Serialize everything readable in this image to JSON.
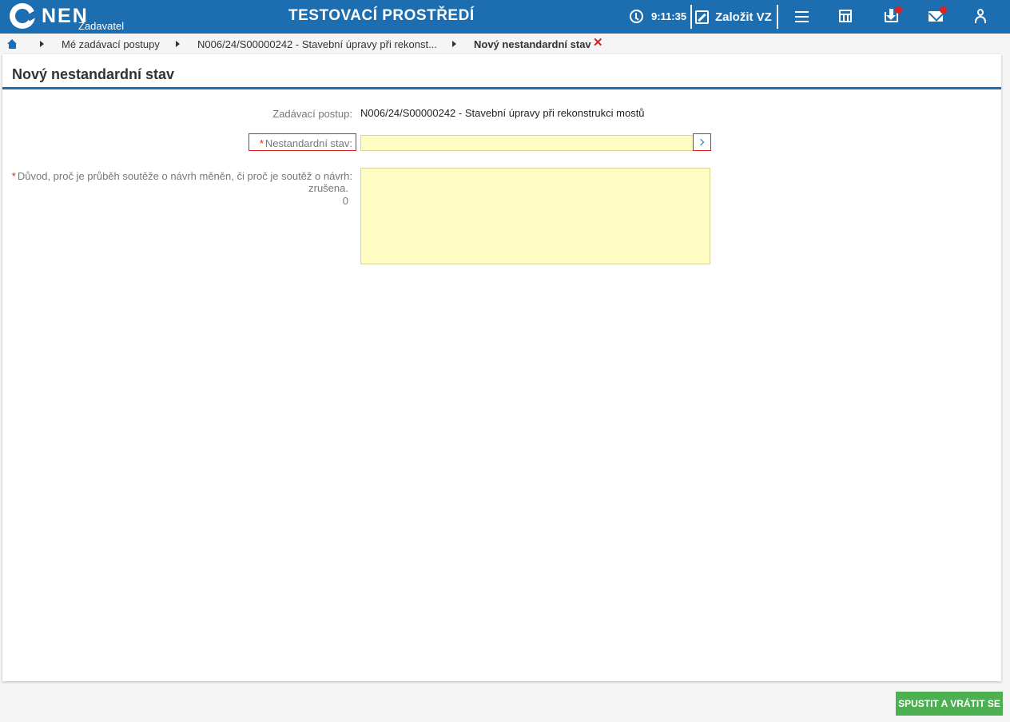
{
  "header": {
    "logo_text": "NEN",
    "logo_subtitle": "Zadavatel",
    "environment_title": "TESTOVACÍ PROSTŘEDÍ",
    "time": "9:11:35",
    "create_label": "Založit VZ",
    "icons": [
      "clock-icon",
      "edit-icon",
      "menu-icon",
      "calculator-icon",
      "inbox-icon",
      "mail-icon",
      "user-icon"
    ],
    "notification_color": "#e0201b"
  },
  "breadcrumb": {
    "items": [
      {
        "label": "Mé zadávací postupy"
      },
      {
        "label": "N006/24/S00000242 - Stavební úpravy při rekonst..."
      },
      {
        "label": "Nový nestandardní stav"
      }
    ]
  },
  "page": {
    "title": "Nový nestandardní stav",
    "procedure_label": "Zadávací postup:",
    "procedure_value": "N006/24/S00000242 - Stavební úpravy při rekonstrukci mostů",
    "state_label": "Nestandardní stav:",
    "state_value": "",
    "reason_label_line1": "Důvod, proč je průběh soutěže o návrh měněn, či proč je soutěž o návrh:",
    "reason_label_line2": "zrušena.",
    "reason_char_count": "0",
    "reason_value": ""
  },
  "actions": {
    "submit_label": "SPUSTIT A VRÁTIT SE"
  },
  "colors": {
    "brand": "#1c6eb1",
    "required": "#e0201b",
    "input_fill": "#fffcc4",
    "action": "#4caf50"
  }
}
